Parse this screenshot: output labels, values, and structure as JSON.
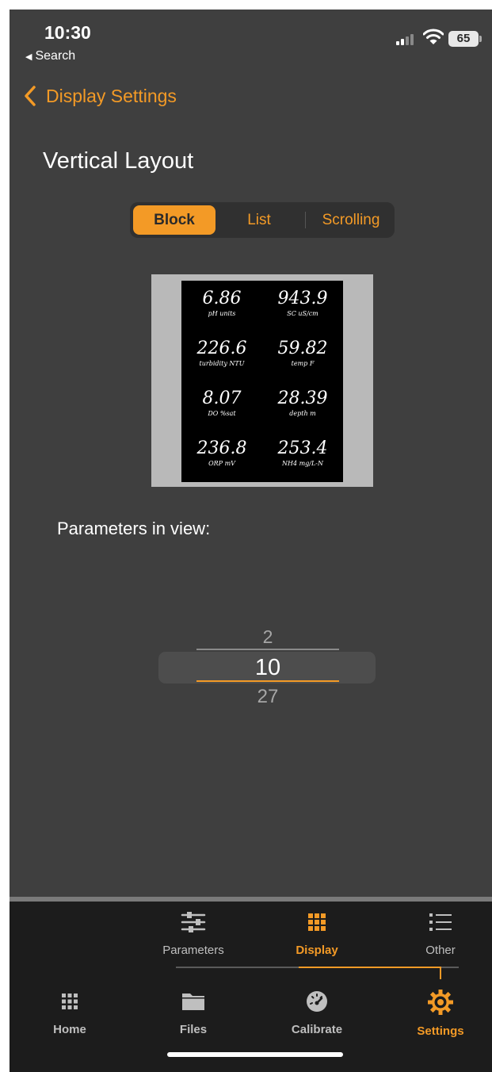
{
  "status": {
    "time": "10:30",
    "back_label": "Search",
    "battery": "65"
  },
  "nav": {
    "back_label": "Display Settings"
  },
  "page": {
    "title": "Vertical Layout"
  },
  "segments": [
    {
      "label": "Block",
      "active": true
    },
    {
      "label": "List",
      "active": false
    },
    {
      "label": "Scrolling",
      "active": false
    }
  ],
  "preview": {
    "cells": [
      {
        "value": "6.86",
        "unit": "pH units"
      },
      {
        "value": "943.9",
        "unit": "SC uS/cm"
      },
      {
        "value": "226.6",
        "unit": "turbidity NTU"
      },
      {
        "value": "59.82",
        "unit": "temp F"
      },
      {
        "value": "8.07",
        "unit": "DO %sat"
      },
      {
        "value": "28.39",
        "unit": "depth m"
      },
      {
        "value": "236.8",
        "unit": "ORP mV"
      },
      {
        "value": "253.4",
        "unit": "NH4 mg/L-N"
      }
    ]
  },
  "params": {
    "label": "Parameters in view:"
  },
  "picker": {
    "options": [
      "2",
      "10",
      "27"
    ],
    "selected": "10"
  },
  "sub_tabs": [
    {
      "label": "Parameters",
      "icon": "sliders-icon",
      "active": false
    },
    {
      "label": "Display",
      "icon": "grid-icon",
      "active": true
    },
    {
      "label": "Other",
      "icon": "list-icon",
      "active": false
    }
  ],
  "main_tabs": [
    {
      "label": "Home",
      "icon": "grid-icon",
      "active": false
    },
    {
      "label": "Files",
      "icon": "folder-icon",
      "active": false
    },
    {
      "label": "Calibrate",
      "icon": "gauge-icon",
      "active": false
    },
    {
      "label": "Settings",
      "icon": "gear-icon",
      "active": true
    }
  ],
  "colors": {
    "accent": "#f39a26",
    "background": "#3f3f3f",
    "tab_bar": "#1c1c1c"
  }
}
